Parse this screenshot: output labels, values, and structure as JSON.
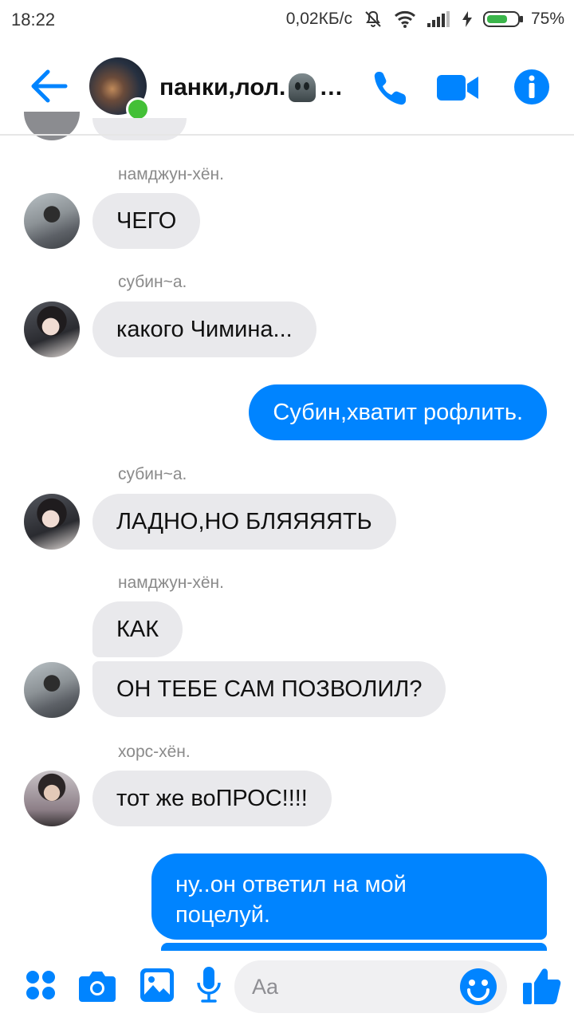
{
  "status_bar": {
    "time": "18:22",
    "speed": "0,02КБ/с",
    "battery": "75%",
    "battery_level": 0.75
  },
  "header": {
    "title": "панки,лол.",
    "ellipsis": "…",
    "back_icon": "arrow-left-icon",
    "call_icon": "phone-icon",
    "video_icon": "video-camera-icon",
    "info_icon": "info-icon",
    "accent": "#0084ff",
    "online_color": "#43c037"
  },
  "messages": [
    {
      "sender": "намджун-хён.",
      "text": "ЧЕГО"
    },
    {
      "sender": "субин~а.",
      "text": "какого Чимина..."
    },
    {
      "outgoing": true,
      "text": "Субин,хватит рофлить."
    },
    {
      "sender": "субин~а.",
      "text": "ЛАДНО,НО БЛЯЯЯЯТЬ"
    },
    {
      "sender": "намджун-хён.",
      "text": "КАК"
    },
    {
      "text": "ОН ТЕБЕ САМ ПОЗВОЛИЛ?"
    },
    {
      "sender": "хорс-хён.",
      "text": "тот же воПРОС!!!!"
    },
    {
      "outgoing": true,
      "text_line1": "ну..он ответил на мой",
      "text_line2": "поцелуй."
    }
  ],
  "composer": {
    "placeholder": "Aa",
    "icons": [
      "apps-icon",
      "camera-icon",
      "gallery-icon",
      "microphone-icon",
      "emoji-icon",
      "like-icon"
    ]
  },
  "colors": {
    "incoming_bubble": "#e9e9ec",
    "outgoing_bubble": "#0084ff"
  }
}
